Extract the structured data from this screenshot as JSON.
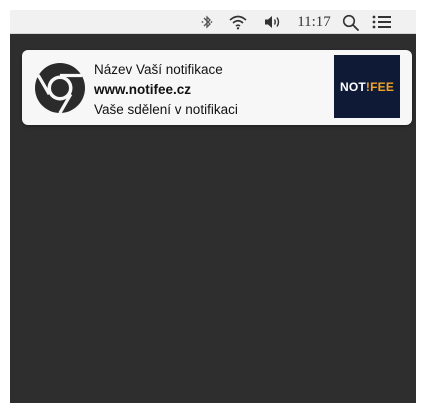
{
  "menubar": {
    "icons": [
      "bluetooth-icon",
      "wifi-icon",
      "volume-icon",
      "search-icon",
      "list-icon"
    ],
    "clock": "11:17"
  },
  "notification": {
    "icon": "chrome-icon",
    "title": "Název Vaší notifikace",
    "site": "www.notifee.cz",
    "body": "Vaše sdělení v notifikaci",
    "image_logo": {
      "part_white": "NOT",
      "part_orange": "!FEE",
      "text": "NOT!FEE"
    }
  },
  "colors": {
    "desktop_background": "#2e2e2f",
    "menubar_background": "#f1f1f1",
    "notification_background": "#f7f7f7",
    "logo_background": "#0f1b36",
    "logo_accent": "#f0a326"
  }
}
